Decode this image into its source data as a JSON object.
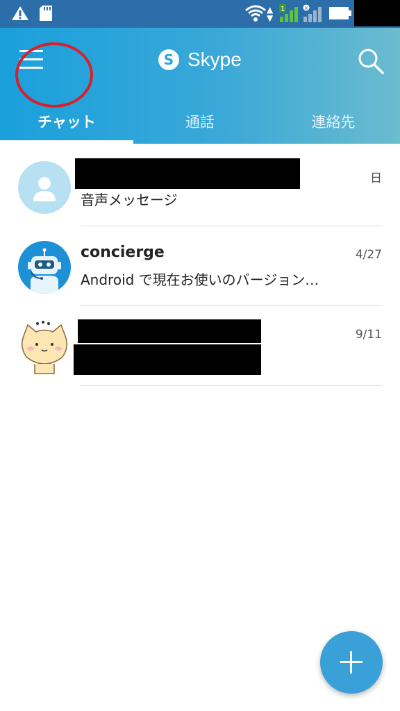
{
  "app": {
    "title": "Skype"
  },
  "colors": {
    "header_start": "#1aa0dc",
    "header_end": "#6bbcce",
    "accent": "#3aa0d8",
    "highlight_circle": "#d6202a"
  },
  "tabs": [
    {
      "label": "チャット",
      "active": true
    },
    {
      "label": "通話",
      "active": false
    },
    {
      "label": "連絡先",
      "active": false
    }
  ],
  "chats": [
    {
      "name": "",
      "name_redacted": true,
      "date": "日",
      "preview": "音声メッセージ",
      "avatar": "default-person-icon"
    },
    {
      "name": "concierge",
      "name_redacted": false,
      "date": "4/27",
      "preview": "Android で現在お使いのバージョン…",
      "avatar": "robot-icon"
    },
    {
      "name": "",
      "name_redacted": true,
      "date": "9/11",
      "preview": "",
      "preview_redacted": true,
      "avatar": "cat-sticker-icon"
    }
  ],
  "icons": {
    "menu": "hamburger-menu-icon",
    "search": "search-icon",
    "fab": "plus-icon"
  }
}
